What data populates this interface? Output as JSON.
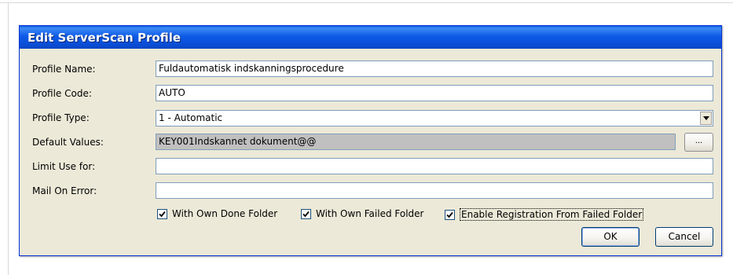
{
  "dialog": {
    "title": "Edit ServerScan Profile"
  },
  "fields": {
    "profile_name": {
      "label": "Profile Name:",
      "value": "Fuldautomatisk indskanningsprocedure"
    },
    "profile_code": {
      "label": "Profile Code:",
      "value": "AUTO"
    },
    "profile_type": {
      "label": "Profile Type:",
      "value": "1 - Automatic"
    },
    "default_values": {
      "label": "Default Values:",
      "value": "KEY001Indskannet dokument@@",
      "button_label": "..."
    },
    "limit_use_for": {
      "label": "Limit Use for:",
      "value": ""
    },
    "mail_on_error": {
      "label": "Mail On Error:",
      "value": ""
    }
  },
  "checkboxes": [
    {
      "label": "With Own Done Folder",
      "checked": true
    },
    {
      "label": "With Own Failed Folder",
      "checked": true
    },
    {
      "label": "Enable Registration From Failed Folder",
      "checked": true
    }
  ],
  "buttons": {
    "ok_label": "OK",
    "cancel_label": "Cancel"
  },
  "colors": {
    "titlebar": "#0a4ed6",
    "dialog_bg": "#ece9d8",
    "readonly_bg": "#c0c0c0"
  }
}
